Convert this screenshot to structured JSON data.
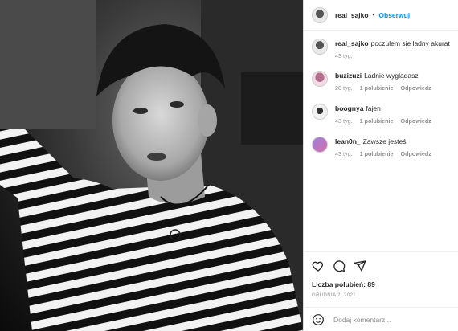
{
  "post": {
    "username": "real_sajko",
    "follow_label": "Obserwuj",
    "separator": "•",
    "caption": "poczulem sie ladny akurat",
    "caption_age": "43 tyg.",
    "likes_text": "Liczba polubień: 89",
    "date": "GRUDNIA 2, 2021"
  },
  "comments": [
    {
      "user": "buzizuzi",
      "text": "Ładnie wyglądasz",
      "age": "20 tyg.",
      "likes": "1 polubienie",
      "reply": "Odpowiedz"
    },
    {
      "user": "boognya",
      "text": "fajen",
      "age": "43 tyg.",
      "likes": "1 polubienie",
      "reply": "Odpowiedz"
    },
    {
      "user": "lean0n_",
      "text": "Zawsze jesteś",
      "age": "43 tyg.",
      "likes": "1 polubienie",
      "reply": "Odpowiedz"
    }
  ],
  "add_comment": {
    "placeholder": "Dodaj komentarz..."
  },
  "colors": {
    "link": "#0095f6",
    "muted": "#8e8e8e",
    "text": "#262626"
  },
  "icons": [
    "heart-icon",
    "comment-icon",
    "share-icon",
    "emoji-icon"
  ]
}
